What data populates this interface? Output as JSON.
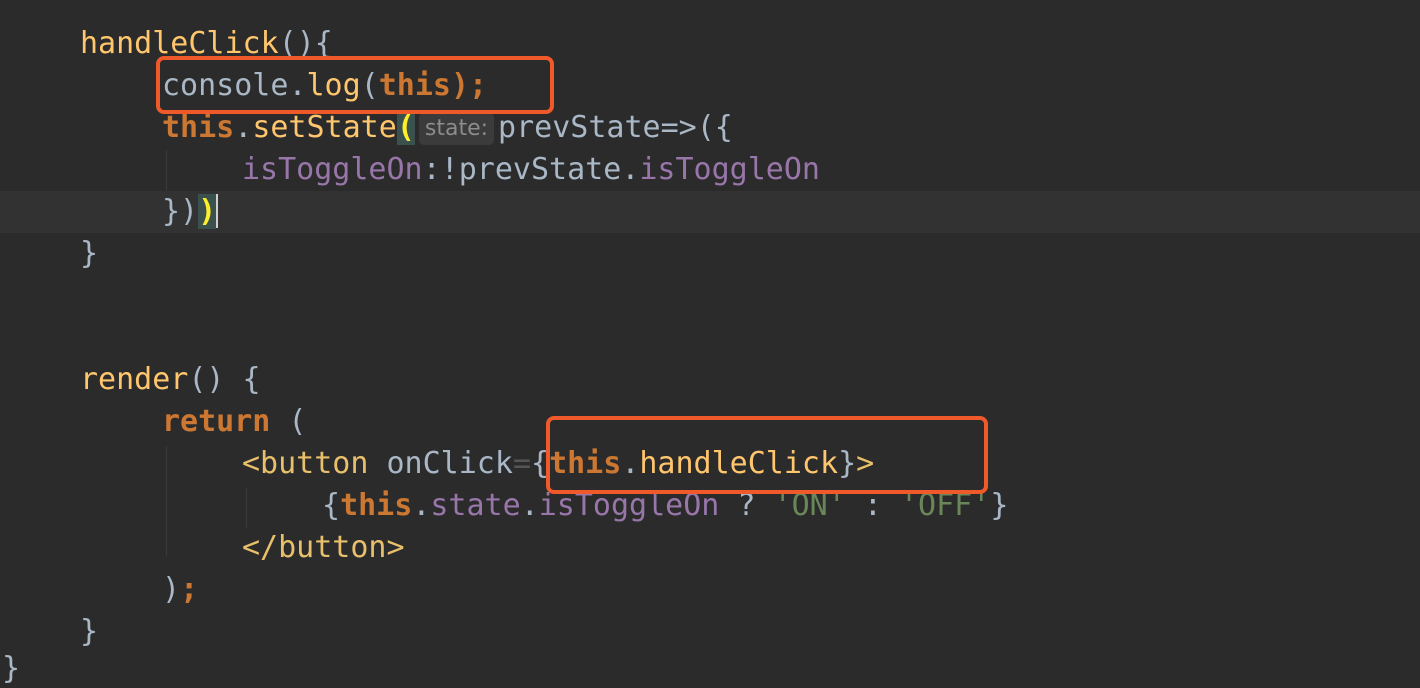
{
  "code": {
    "line1": {
      "method": "handleClick",
      "paren_brace": "(){"
    },
    "line2": {
      "obj": "console",
      "dot": ".",
      "method": "log",
      "open": "(",
      "this": "this",
      "close": ");"
    },
    "line3": {
      "this": "this",
      "dot": ".",
      "method": "setState",
      "open": "(",
      "hint": "state:",
      "rest": "prevState=>({"
    },
    "line4": {
      "prop": "isToggleOn",
      "colon": ":!",
      "obj": "prevState",
      "dot": ".",
      "prop2": "isToggleOn"
    },
    "line5": {
      "close": "})",
      "paren": ")"
    },
    "line6": {
      "brace": "}"
    },
    "line9": {
      "method": "render",
      "rest": "() {"
    },
    "line10": {
      "kw": "return",
      "rest": " ("
    },
    "line11": {
      "tag": "<button",
      "attr": " onClick",
      "eq": "=",
      "open": "{",
      "this": "this",
      "dot": ".",
      "method": "handleClick",
      "close": "}",
      "gt": ">"
    },
    "line12": {
      "open": "{",
      "this": "this",
      "dot1": ".",
      "prop": "state",
      "dot2": ".",
      "prop2": "isToggleOn",
      "q": " ? ",
      "on": "'ON'",
      "colon": " : ",
      "off": "'OFF'",
      "close": "}"
    },
    "line13": {
      "tag": "</button>"
    },
    "line14": {
      "close": ")",
      "semi": ";"
    },
    "line15": {
      "brace": "}"
    },
    "line16": {
      "brace": "}"
    }
  },
  "colors": {
    "background": "#2b2b2b",
    "highlight_box": "#f0592a",
    "keyword": "#cc7832",
    "function": "#ffc66d",
    "property": "#9876aa",
    "string": "#6a8759"
  }
}
